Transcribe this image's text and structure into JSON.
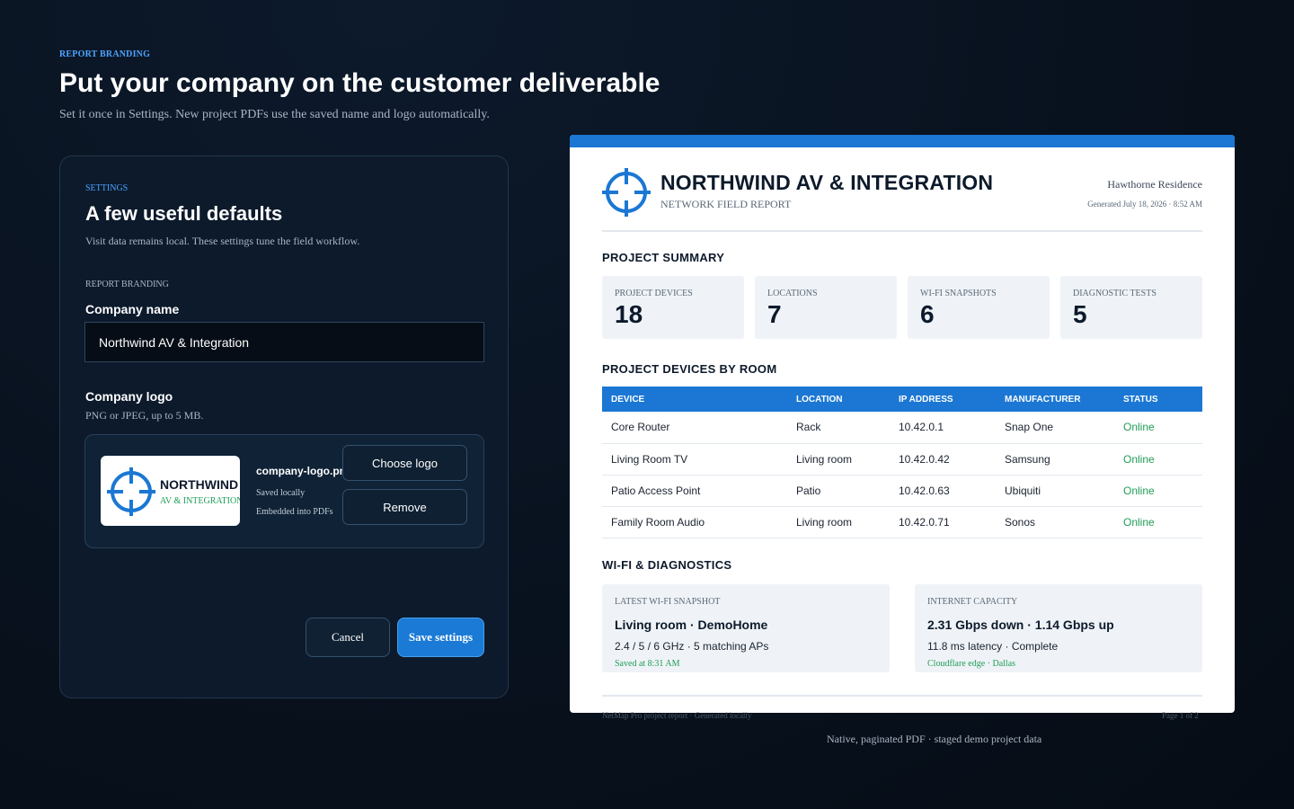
{
  "hero": {
    "eyebrow": "REPORT BRANDING",
    "title": "Put your company on the customer deliverable",
    "subtitle": "Set it once in Settings. New project PDFs use the saved name and logo automatically."
  },
  "settings": {
    "eyebrow": "SETTINGS",
    "title": "A few useful defaults",
    "description": "Visit data remains local. These settings tune the field workflow.",
    "section_label": "REPORT BRANDING",
    "company_name_label": "Company name",
    "company_name_value": "Northwind AV & Integration",
    "company_logo_label": "Company logo",
    "company_logo_hint": "PNG or JPEG, up to 5 MB.",
    "logo_preview": {
      "name": "NORTHWIND",
      "tagline": "AV & INTEGRATION",
      "icon": "crosshair-icon"
    },
    "file_name": "company-logo.png",
    "file_saved": "Saved locally",
    "file_embedded": "Embedded into PDFs",
    "choose_label": "Choose logo",
    "remove_label": "Remove",
    "cancel_label": "Cancel",
    "save_label": "Save settings"
  },
  "report": {
    "company": "NORTHWIND AV & INTEGRATION",
    "subtitle": "NETWORK FIELD REPORT",
    "project": "Hawthorne Residence",
    "generated": "Generated July 18, 2026 · 8:52 AM",
    "summary_heading": "PROJECT SUMMARY",
    "stats": [
      {
        "label": "PROJECT DEVICES",
        "value": "18"
      },
      {
        "label": "LOCATIONS",
        "value": "7"
      },
      {
        "label": "WI-FI SNAPSHOTS",
        "value": "6"
      },
      {
        "label": "DIAGNOSTIC TESTS",
        "value": "5"
      }
    ],
    "devices_heading": "PROJECT DEVICES BY ROOM",
    "table": {
      "headers": [
        "DEVICE",
        "LOCATION",
        "IP ADDRESS",
        "MANUFACTURER",
        "STATUS"
      ],
      "rows": [
        [
          "Core Router",
          "Rack",
          "10.42.0.1",
          "Snap One",
          "Online"
        ],
        [
          "Living Room TV",
          "Living room",
          "10.42.0.42",
          "Samsung",
          "Online"
        ],
        [
          "Patio Access Point",
          "Patio",
          "10.42.0.63",
          "Ubiquiti",
          "Online"
        ],
        [
          "Family Room Audio",
          "Living room",
          "10.42.0.71",
          "Sonos",
          "Online"
        ]
      ]
    },
    "wifi_heading": "WI-FI & DIAGNOSTICS",
    "wifi_card": {
      "label": "LATEST WI-FI SNAPSHOT",
      "title": "Living room · DemoHome",
      "detail": "2.4 / 5 / 6 GHz · 5 matching APs",
      "meta": "Saved at 8:31 AM"
    },
    "internet_card": {
      "label": "INTERNET CAPACITY",
      "title": "2.31 Gbps down · 1.14 Gbps up",
      "detail": "11.8 ms latency · Complete",
      "meta": "Cloudflare edge · Dallas"
    },
    "footer_left": "NetMap Pro project report · Generated locally",
    "footer_right": "Page 1 of 2"
  },
  "caption": "Native, paginated PDF · staged demo project data",
  "colors": {
    "accent": "#1b77d3",
    "online": "#1f9d57",
    "panel": "#0c1a2b",
    "background": "#08111d"
  }
}
